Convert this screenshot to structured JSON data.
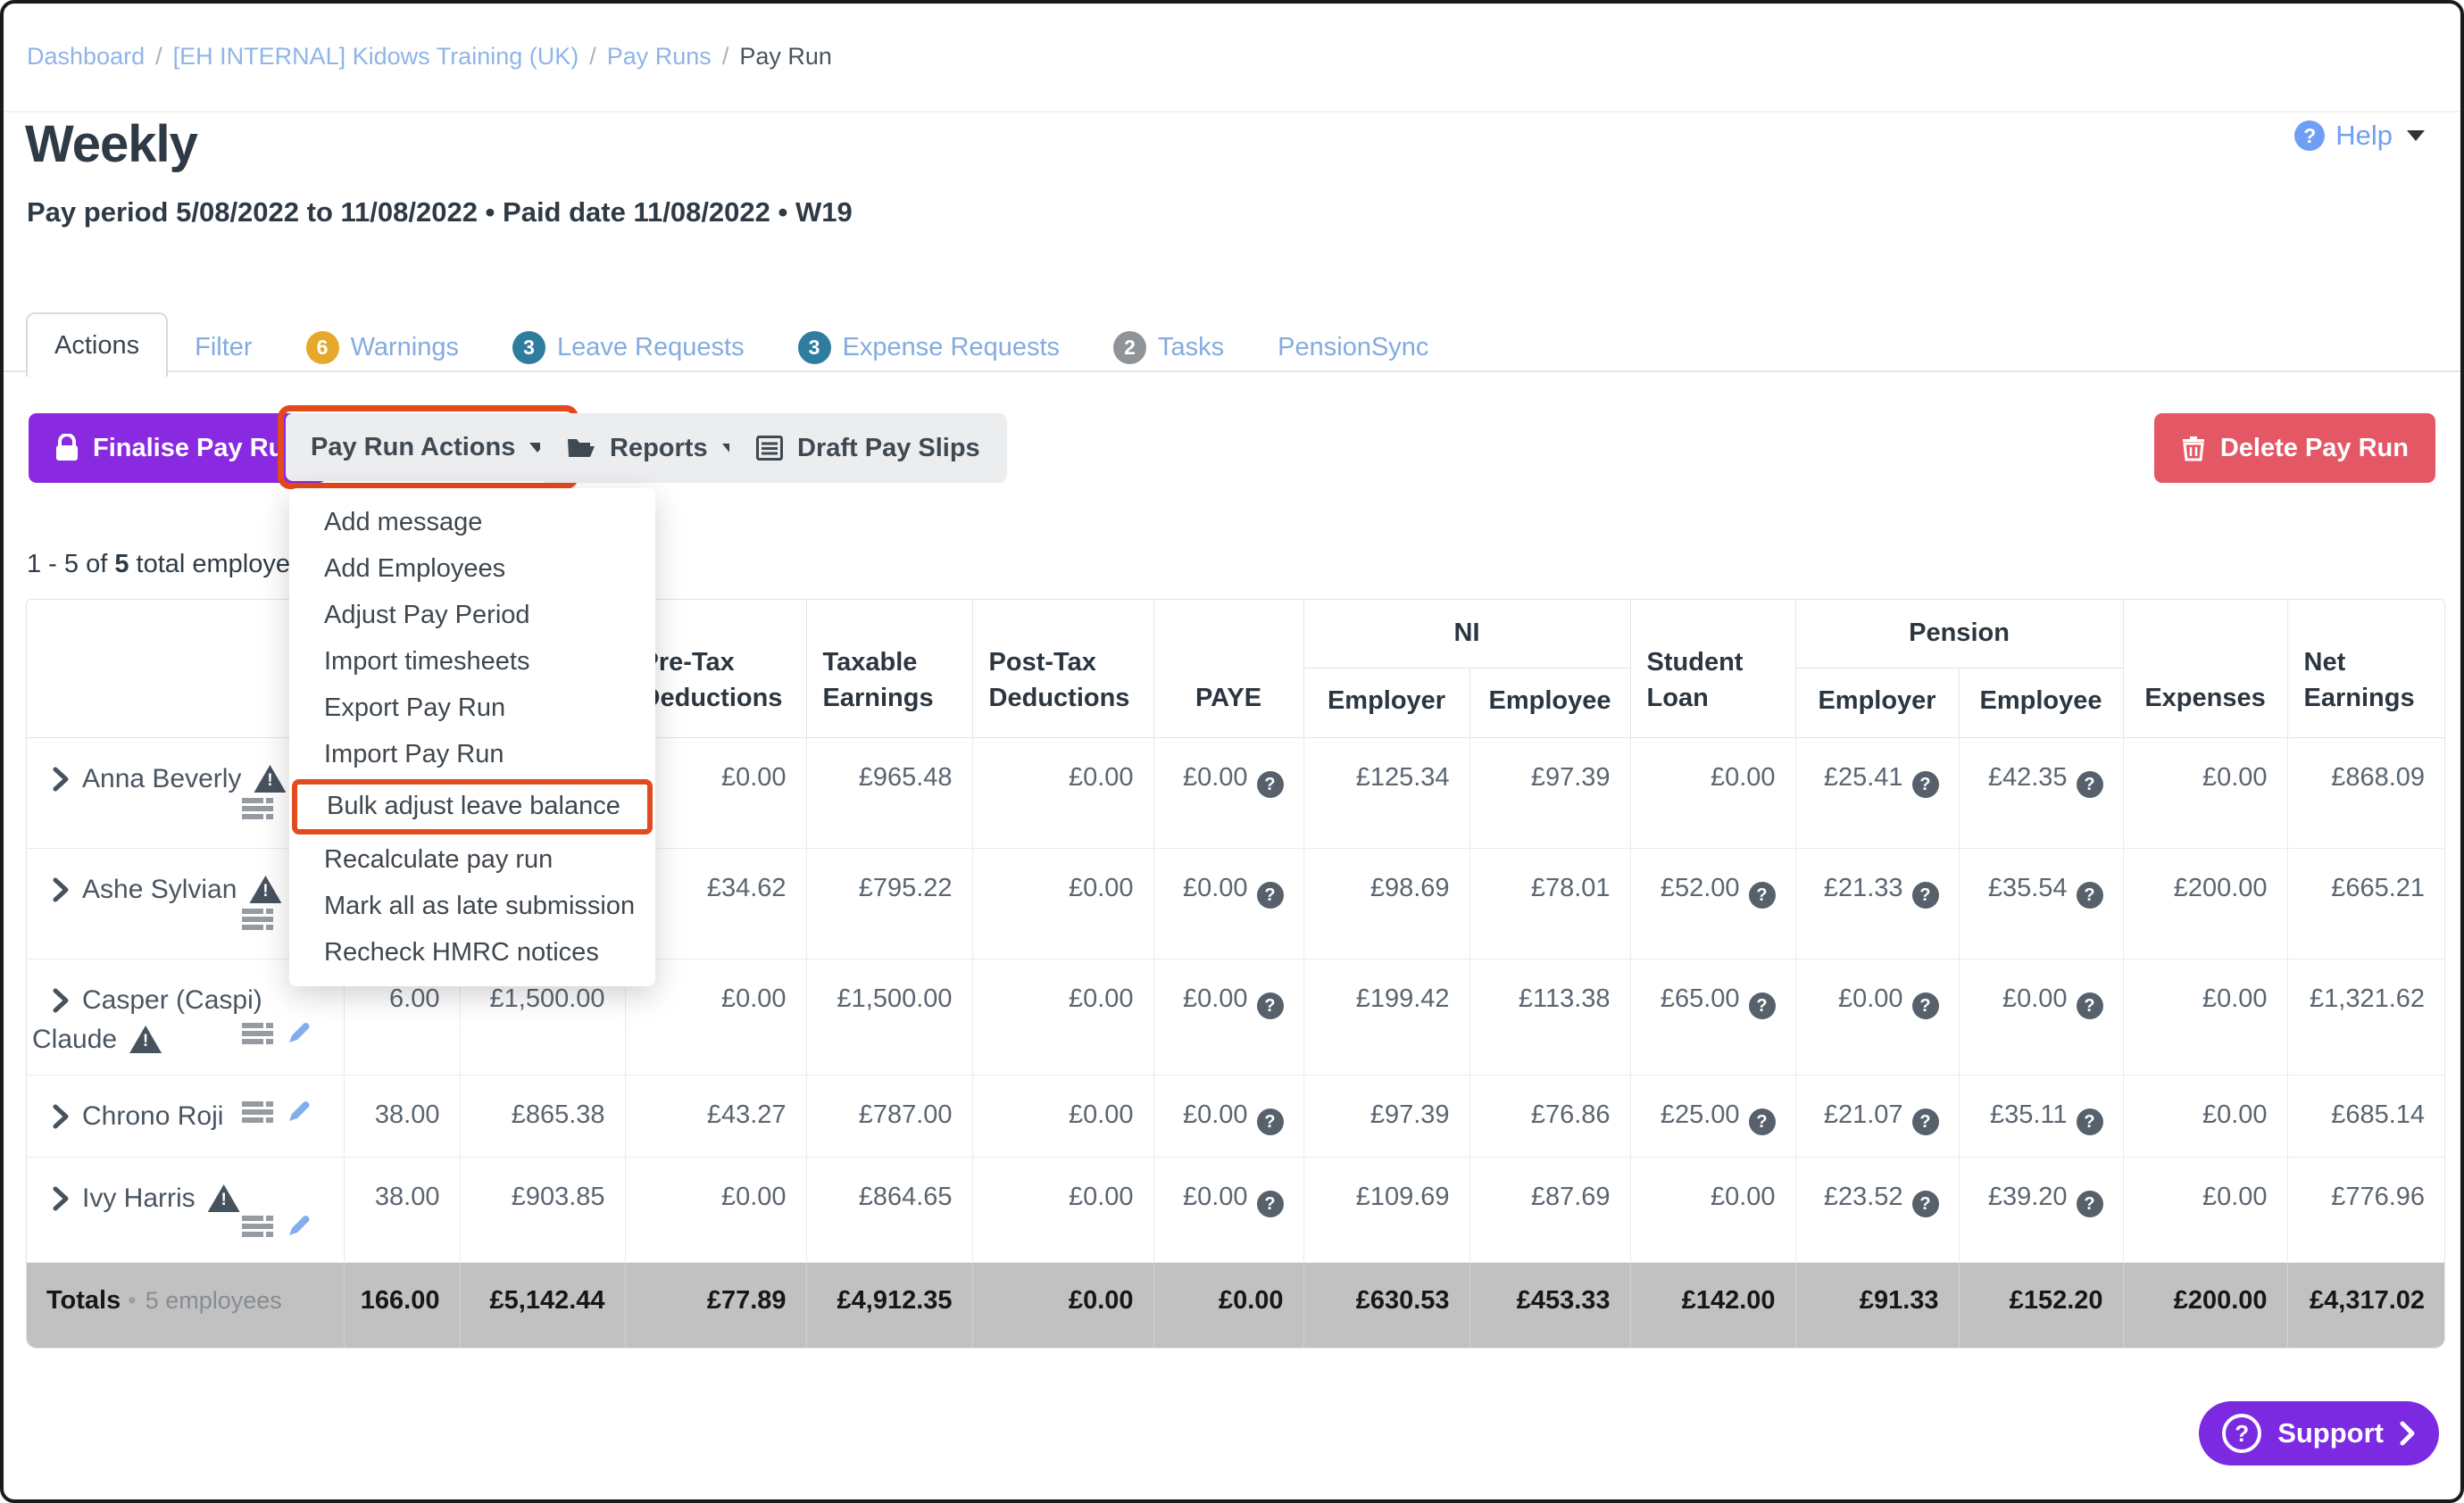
{
  "breadcrumb": {
    "items": [
      "Dashboard",
      "[EH INTERNAL] Kidows Training (UK)",
      "Pay Runs",
      "Pay Run"
    ],
    "separator": "/"
  },
  "header": {
    "title": "Weekly",
    "subtitle": "Pay period 5/08/2022 to 11/08/2022 • Paid date 11/08/2022 • W19",
    "help": "Help"
  },
  "tabs": [
    {
      "label": "Actions"
    },
    {
      "label": "Filter"
    },
    {
      "label": "Warnings",
      "badge": "6",
      "badge_color": "#e6a92c"
    },
    {
      "label": "Leave Requests",
      "badge": "3",
      "badge_color": "#2f7d9e"
    },
    {
      "label": "Expense Requests",
      "badge": "3",
      "badge_color": "#2f7d9e"
    },
    {
      "label": "Tasks",
      "badge": "2",
      "badge_color": "#8f9499"
    },
    {
      "label": "PensionSync"
    }
  ],
  "toolbar": {
    "finalise": "Finalise Pay Run",
    "pay_run_actions": "Pay Run Actions",
    "reports": "Reports",
    "draft_pay_slips": "Draft Pay Slips",
    "delete": "Delete Pay Run"
  },
  "menu": {
    "items": [
      "Add message",
      "Add Employees",
      "Adjust Pay Period",
      "Import timesheets",
      "Export Pay Run",
      "Import Pay Run",
      "Bulk adjust leave balance",
      "Recalculate pay run",
      "Mark all as late submission",
      "Recheck HMRC notices"
    ],
    "highlighted_item": "Bulk adjust leave balance"
  },
  "summary": {
    "prefix": "1 - 5 of ",
    "count": "5",
    "suffix": " total employees"
  },
  "table": {
    "group_headers": {
      "ni": "NI",
      "pension": "Pension"
    },
    "headers": {
      "pre_tax": "Pre-Tax Deductions",
      "taxable": "Taxable Earnings",
      "post_tax": "Post-Tax Deductions",
      "paye": "PAYE",
      "employer": "Employer",
      "employee": "Employee",
      "student_loan": "Student Loan",
      "expenses": "Expenses",
      "net_earnings": "Net Earnings"
    },
    "rows": [
      {
        "name": "Anna Beverly",
        "hours": "",
        "gross": "",
        "pre_tax": "£0.00",
        "taxable": "£965.48",
        "post_tax": "£0.00",
        "paye": "£0.00",
        "ni_employer": "£125.34",
        "ni_employee": "£97.39",
        "student_loan": "£0.00",
        "pension_employer": "£25.41",
        "pension_employee": "£42.35",
        "expenses": "£0.00",
        "net": "£868.09"
      },
      {
        "name": "Ashe Sylvian",
        "hours": "",
        "gross": "",
        "pre_tax": "£34.62",
        "taxable": "£795.22",
        "post_tax": "£0.00",
        "paye": "£0.00",
        "ni_employer": "£98.69",
        "ni_employee": "£78.01",
        "student_loan": "£52.00",
        "pension_employer": "£21.33",
        "pension_employee": "£35.54",
        "expenses": "£200.00",
        "net": "£665.21"
      },
      {
        "name": "Casper (Caspi)",
        "name_line2": "Claude",
        "hours": "6.00",
        "gross": "£1,500.00",
        "pre_tax": "£0.00",
        "taxable": "£1,500.00",
        "post_tax": "£0.00",
        "paye": "£0.00",
        "ni_employer": "£199.42",
        "ni_employee": "£113.38",
        "student_loan": "£65.00",
        "pension_employer": "£0.00",
        "pension_employee": "£0.00",
        "expenses": "£0.00",
        "net": "£1,321.62"
      },
      {
        "name": "Chrono Roji",
        "hours": "38.00",
        "gross": "£865.38",
        "pre_tax": "£43.27",
        "taxable": "£787.00",
        "post_tax": "£0.00",
        "paye": "£0.00",
        "ni_employer": "£97.39",
        "ni_employee": "£76.86",
        "student_loan": "£25.00",
        "pension_employer": "£21.07",
        "pension_employee": "£35.11",
        "expenses": "£0.00",
        "net": "£685.14"
      },
      {
        "name": "Ivy Harris",
        "hours": "38.00",
        "gross": "£903.85",
        "pre_tax": "£0.00",
        "taxable": "£864.65",
        "post_tax": "£0.00",
        "paye": "£0.00",
        "ni_employer": "£109.69",
        "ni_employee": "£87.69",
        "student_loan": "£0.00",
        "pension_employer": "£23.52",
        "pension_employee": "£39.20",
        "expenses": "£0.00",
        "net": "£776.96"
      }
    ],
    "totals": {
      "label": "Totals",
      "note": "5 employees",
      "hours": "166.00",
      "gross": "£5,142.44",
      "pre_tax": "£77.89",
      "taxable": "£4,912.35",
      "post_tax": "£0.00",
      "paye": "£0.00",
      "ni_employer": "£630.53",
      "ni_employee": "£453.33",
      "student_loan": "£142.00",
      "pension_employer": "£91.33",
      "pension_employee": "£152.20",
      "expenses": "£200.00",
      "net": "£4,317.02"
    }
  },
  "support": {
    "label": "Support"
  },
  "colors": {
    "accent_purple": "#8a2ae0",
    "support_purple": "#7c2ae2",
    "delete_red": "#e45866",
    "highlight_orange": "#e4491c",
    "link_blue": "#84abe0",
    "breadcrumb_blue": "#8fb4e8",
    "help_blue": "#6f9ff4",
    "badge_amber": "#e6a92c",
    "badge_steel_blue": "#2f7d9e",
    "badge_gray": "#8f9499",
    "totals_bg": "#c1c1c1",
    "dark_text": "#2e3a45"
  }
}
